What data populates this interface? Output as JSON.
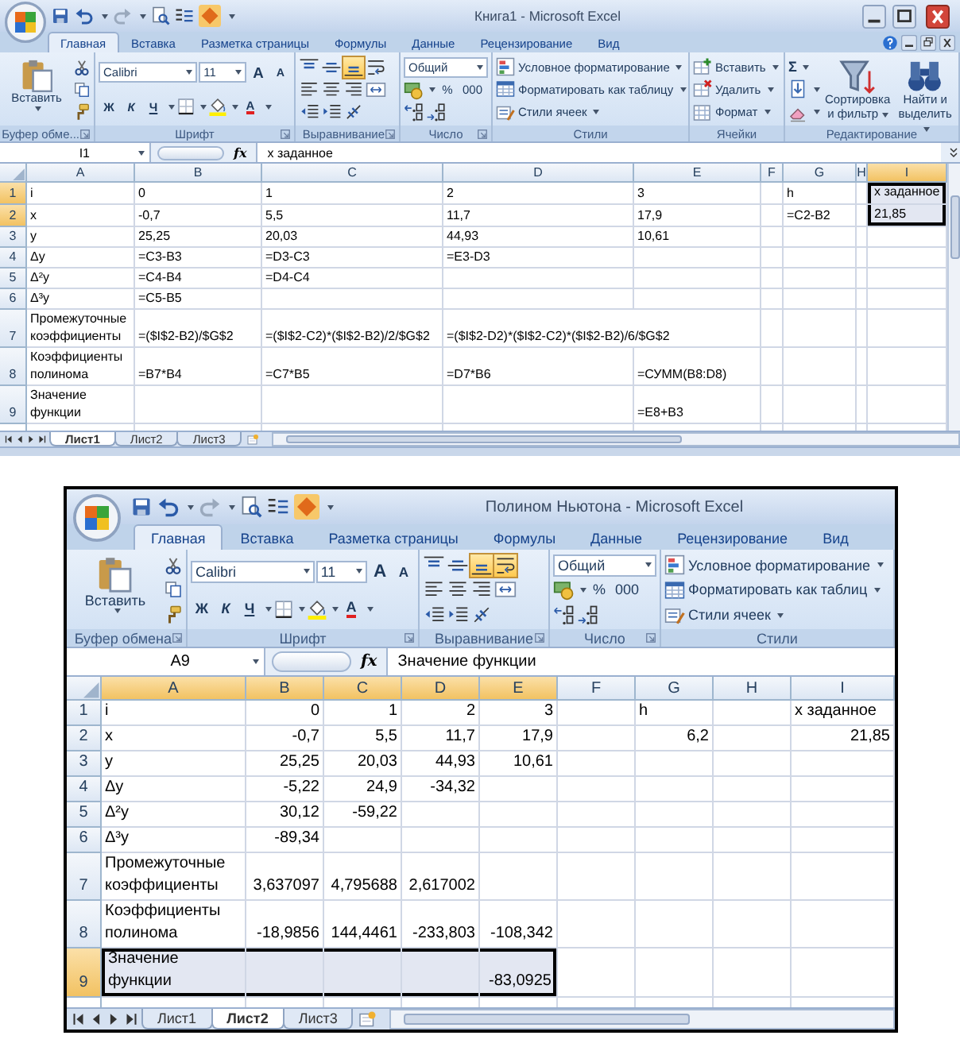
{
  "windows": [
    {
      "title": "Книга1 - Microsoft Excel",
      "tabs": [
        {
          "label": "Главная",
          "selected": true
        },
        {
          "label": "Вставка",
          "selected": false
        },
        {
          "label": "Разметка страницы",
          "selected": false
        },
        {
          "label": "Формулы",
          "selected": false
        },
        {
          "label": "Данные",
          "selected": false
        },
        {
          "label": "Рецензирование",
          "selected": false
        },
        {
          "label": "Вид",
          "selected": false
        }
      ],
      "ribbon": [
        {
          "kind": "clipboard",
          "label": "Буфер обме...",
          "paste": "Вставить"
        },
        {
          "kind": "font",
          "label": "Шрифт",
          "font": "Calibri",
          "size": "11",
          "grow": "A",
          "shrink": "A",
          "bold": "Ж",
          "italic": "К",
          "underline": "Ч",
          "font_color": "A"
        },
        {
          "kind": "alignment",
          "label": "Выравнивание",
          "buttons": [
            {
              "selected": false
            },
            {
              "selected": false
            },
            {
              "selected": true
            },
            {
              "selected": false
            },
            {
              "selected": false
            },
            {
              "selected": false
            },
            {
              "selected": false
            },
            {
              "selected": false
            },
            {
              "selected": false
            },
            {
              "selected": false
            },
            {
              "selected": false
            }
          ]
        },
        {
          "kind": "number",
          "label": "Число",
          "format": "Общий",
          "percent": "%",
          "thousands": "000"
        },
        {
          "kind": "styles",
          "label": "Стили",
          "items": [
            "Условное форматирование",
            "Форматировать как таблицу",
            "Стили ячеек"
          ]
        },
        {
          "kind": "cells",
          "label": "Ячейки",
          "items": [
            "Вставить",
            "Удалить",
            "Формат"
          ]
        },
        {
          "kind": "editing",
          "label": "Редактирование",
          "sum": "Σ",
          "sort": "Сортировка и фильтр",
          "find": "Найти и выделить"
        }
      ],
      "name_box": "I1",
      "formula_button": "fx",
      "formula": "x заданное",
      "columns": [
        {
          "label": "A",
          "selected": false
        },
        {
          "label": "B",
          "selected": false
        },
        {
          "label": "C",
          "selected": false
        },
        {
          "label": "D",
          "selected": false
        },
        {
          "label": "E",
          "selected": false
        },
        {
          "label": "F",
          "selected": false
        },
        {
          "label": "G",
          "selected": false
        },
        {
          "label": "H",
          "selected": false
        },
        {
          "label": "I",
          "selected": true
        }
      ],
      "rows": [
        {
          "label": "1",
          "selected": true,
          "cells": [
            {
              "text": "i",
              "kind": "text",
              "selected": false
            },
            {
              "text": "0",
              "kind": "text",
              "selected": false
            },
            {
              "text": "1",
              "kind": "text",
              "selected": false
            },
            {
              "text": "2",
              "kind": "text",
              "selected": false
            },
            {
              "text": "3",
              "kind": "text",
              "selected": false
            },
            {
              "selected": false
            },
            {
              "text": "h",
              "kind": "text",
              "selected": false
            },
            {
              "selected": false
            },
            {
              "text": "x заданное",
              "kind": "text",
              "selected": true
            }
          ]
        },
        {
          "label": "2",
          "selected": true,
          "cells": [
            {
              "text": "x",
              "kind": "text",
              "selected": false
            },
            {
              "text": "-0,7",
              "kind": "text",
              "selected": false
            },
            {
              "text": "5,5",
              "kind": "text",
              "selected": false
            },
            {
              "text": "11,7",
              "kind": "text",
              "selected": false
            },
            {
              "text": "17,9",
              "kind": "text",
              "selected": false
            },
            {
              "selected": false
            },
            {
              "text": "=C2-B2",
              "kind": "text",
              "selected": false
            },
            {
              "selected": false
            },
            {
              "text": "21,85",
              "kind": "text",
              "selected": true
            }
          ]
        },
        {
          "label": "3",
          "selected": false,
          "cells": [
            {
              "text": "y",
              "kind": "text",
              "selected": false
            },
            {
              "text": "25,25",
              "kind": "text",
              "selected": false
            },
            {
              "text": "20,03",
              "kind": "text",
              "selected": false
            },
            {
              "text": "44,93",
              "kind": "text",
              "selected": false
            },
            {
              "text": "10,61",
              "kind": "text",
              "selected": false
            },
            {
              "selected": false
            },
            {
              "selected": false
            },
            {
              "selected": false
            },
            {
              "selected": false
            }
          ]
        },
        {
          "label": "4",
          "selected": false,
          "cells": [
            {
              "text": "Δy",
              "kind": "text",
              "selected": false
            },
            {
              "text": "=C3-B3",
              "kind": "text",
              "selected": false
            },
            {
              "text": "=D3-C3",
              "kind": "text",
              "selected": false
            },
            {
              "text": "=E3-D3",
              "kind": "text",
              "selected": false
            },
            {
              "selected": false
            },
            {
              "selected": false
            },
            {
              "selected": false
            },
            {
              "selected": false
            },
            {
              "selected": false
            }
          ]
        },
        {
          "label": "5",
          "selected": false,
          "cells": [
            {
              "text": "Δ²y",
              "kind": "text",
              "selected": false
            },
            {
              "text": "=C4-B4",
              "kind": "text",
              "selected": false
            },
            {
              "text": "=D4-C4",
              "kind": "text",
              "selected": false
            },
            {
              "selected": false
            },
            {
              "selected": false
            },
            {
              "selected": false
            },
            {
              "selected": false
            },
            {
              "selected": false
            },
            {
              "selected": false
            }
          ]
        },
        {
          "label": "6",
          "selected": false,
          "cells": [
            {
              "text": "Δ³y",
              "kind": "text",
              "selected": false
            },
            {
              "text": "=C5-B5",
              "kind": "text",
              "selected": false
            },
            {
              "selected": false
            },
            {
              "selected": false
            },
            {
              "selected": false
            },
            {
              "selected": false
            },
            {
              "selected": false
            },
            {
              "selected": false
            },
            {
              "selected": false
            }
          ]
        },
        {
          "label": "7",
          "selected": false,
          "cells": [
            {
              "text": "Промежуточные коэффициенты",
              "kind": "text",
              "selected": false
            },
            {
              "text": "=($I$2-B2)/$G$2",
              "kind": "text",
              "selected": false
            },
            {
              "text": "=($I$2-C2)*($I$2-B2)/2/$G$2",
              "kind": "text",
              "selected": false
            },
            {
              "text": "=($I$2-D2)*($I$2-C2)*($I$2-B2)/6/$G$2",
              "kind": "text",
              "selected": false
            },
            {
              "selected": false
            },
            {
              "selected": false
            },
            {
              "selected": false
            },
            {
              "selected": false
            },
            {
              "selected": false
            }
          ]
        },
        {
          "label": "8",
          "selected": false,
          "cells": [
            {
              "text": "Коэффициенты полинома",
              "kind": "text",
              "selected": false
            },
            {
              "text": "=B7*B4",
              "kind": "text",
              "selected": false
            },
            {
              "text": "=C7*B5",
              "kind": "text",
              "selected": false
            },
            {
              "text": "=D7*B6",
              "kind": "text",
              "selected": false
            },
            {
              "text": "=СУММ(B8:D8)",
              "kind": "text",
              "selected": false
            },
            {
              "selected": false
            },
            {
              "selected": false
            },
            {
              "selected": false
            },
            {
              "selected": false
            }
          ]
        },
        {
          "label": "9",
          "selected": false,
          "cells": [
            {
              "text": "Значение функции",
              "kind": "text",
              "selected": false
            },
            {
              "selected": false
            },
            {
              "selected": false
            },
            {
              "selected": false
            },
            {
              "text": "=E8+B3",
              "kind": "text",
              "selected": false
            },
            {
              "selected": false
            },
            {
              "selected": false
            },
            {
              "selected": false
            },
            {
              "selected": false
            }
          ]
        }
      ],
      "sheets": [
        {
          "label": "Лист1",
          "selected": true
        },
        {
          "label": "Лист2",
          "selected": false
        },
        {
          "label": "Лист3",
          "selected": false
        }
      ]
    },
    {
      "title": "Полином Ньютона - Microsoft Excel",
      "tabs": [
        {
          "label": "Главная",
          "selected": true
        },
        {
          "label": "Вставка",
          "selected": false
        },
        {
          "label": "Разметка страницы",
          "selected": false
        },
        {
          "label": "Формулы",
          "selected": false
        },
        {
          "label": "Данные",
          "selected": false
        },
        {
          "label": "Рецензирование",
          "selected": false
        },
        {
          "label": "Вид",
          "selected": false
        }
      ],
      "ribbon": [
        {
          "kind": "clipboard",
          "label": "Буфер обмена",
          "paste": "Вставить"
        },
        {
          "kind": "font",
          "label": "Шрифт",
          "font": "Calibri",
          "size": "11",
          "grow": "A",
          "shrink": "A",
          "bold": "Ж",
          "italic": "К",
          "underline": "Ч",
          "font_color": "A"
        },
        {
          "kind": "alignment",
          "label": "Выравнивание",
          "buttons": [
            {
              "selected": false
            },
            {
              "selected": false
            },
            {
              "selected": true
            },
            {
              "selected": true
            },
            {
              "selected": false
            },
            {
              "selected": false
            },
            {
              "selected": false
            },
            {
              "selected": false
            },
            {
              "selected": false
            },
            {
              "selected": false
            },
            {
              "selected": false
            }
          ]
        },
        {
          "kind": "number",
          "label": "Число",
          "format": "Общий",
          "percent": "%",
          "thousands": "000"
        },
        {
          "kind": "styles",
          "label": "Стили",
          "items": [
            "Условное форматирование",
            "Форматировать как таблиц",
            "Стили ячеек"
          ]
        }
      ],
      "name_box": "A9",
      "formula_button": "fx",
      "formula": "Значение функции",
      "columns": [
        {
          "label": "A",
          "selected": true
        },
        {
          "label": "B",
          "selected": true
        },
        {
          "label": "C",
          "selected": true
        },
        {
          "label": "D",
          "selected": true
        },
        {
          "label": "E",
          "selected": true
        },
        {
          "label": "F",
          "selected": false
        },
        {
          "label": "G",
          "selected": false
        },
        {
          "label": "H",
          "selected": false
        },
        {
          "label": "I",
          "selected": false
        }
      ],
      "rows": [
        {
          "label": "1",
          "selected": false,
          "cells": [
            {
              "text": "i",
              "kind": "text",
              "selected": false
            },
            {
              "text": "0",
              "kind": "number",
              "selected": false
            },
            {
              "text": "1",
              "kind": "number",
              "selected": false
            },
            {
              "text": "2",
              "kind": "number",
              "selected": false
            },
            {
              "text": "3",
              "kind": "number",
              "selected": false
            },
            {
              "selected": false
            },
            {
              "text": "h",
              "kind": "text",
              "selected": false
            },
            {
              "selected": false
            },
            {
              "text": "x заданное",
              "kind": "text",
              "selected": false
            }
          ]
        },
        {
          "label": "2",
          "selected": false,
          "cells": [
            {
              "text": "x",
              "kind": "text",
              "selected": false
            },
            {
              "text": "-0,7",
              "kind": "number",
              "selected": false
            },
            {
              "text": "5,5",
              "kind": "number",
              "selected": false
            },
            {
              "text": "11,7",
              "kind": "number",
              "selected": false
            },
            {
              "text": "17,9",
              "kind": "number",
              "selected": false
            },
            {
              "selected": false
            },
            {
              "text": "6,2",
              "kind": "number",
              "selected": false
            },
            {
              "selected": false
            },
            {
              "text": "21,85",
              "kind": "number",
              "selected": false
            }
          ]
        },
        {
          "label": "3",
          "selected": false,
          "cells": [
            {
              "text": "y",
              "kind": "text",
              "selected": false
            },
            {
              "text": "25,25",
              "kind": "number",
              "selected": false
            },
            {
              "text": "20,03",
              "kind": "number",
              "selected": false
            },
            {
              "text": "44,93",
              "kind": "number",
              "selected": false
            },
            {
              "text": "10,61",
              "kind": "number",
              "selected": false
            },
            {
              "selected": false
            },
            {
              "selected": false
            },
            {
              "selected": false
            },
            {
              "selected": false
            }
          ]
        },
        {
          "label": "4",
          "selected": false,
          "cells": [
            {
              "text": "Δy",
              "kind": "text",
              "selected": false
            },
            {
              "text": "-5,22",
              "kind": "number",
              "selected": false
            },
            {
              "text": "24,9",
              "kind": "number",
              "selected": false
            },
            {
              "text": "-34,32",
              "kind": "number",
              "selected": false
            },
            {
              "selected": false
            },
            {
              "selected": false
            },
            {
              "selected": false
            },
            {
              "selected": false
            },
            {
              "selected": false
            }
          ]
        },
        {
          "label": "5",
          "selected": false,
          "cells": [
            {
              "text": "Δ²y",
              "kind": "text",
              "selected": false
            },
            {
              "text": "30,12",
              "kind": "number",
              "selected": false
            },
            {
              "text": "-59,22",
              "kind": "number",
              "selected": false
            },
            {
              "selected": false
            },
            {
              "selected": false
            },
            {
              "selected": false
            },
            {
              "selected": false
            },
            {
              "selected": false
            },
            {
              "selected": false
            }
          ]
        },
        {
          "label": "6",
          "selected": false,
          "cells": [
            {
              "text": "Δ³y",
              "kind": "text",
              "selected": false
            },
            {
              "text": "-89,34",
              "kind": "number",
              "selected": false
            },
            {
              "selected": false
            },
            {
              "selected": false
            },
            {
              "selected": false
            },
            {
              "selected": false
            },
            {
              "selected": false
            },
            {
              "selected": false
            },
            {
              "selected": false
            }
          ]
        },
        {
          "label": "7",
          "selected": false,
          "cells": [
            {
              "text": "Промежуточные коэффициенты",
              "kind": "text",
              "selected": false
            },
            {
              "text": "3,637097",
              "kind": "number",
              "selected": false
            },
            {
              "text": "4,795688",
              "kind": "number",
              "selected": false
            },
            {
              "text": "2,617002",
              "kind": "number",
              "selected": false
            },
            {
              "selected": false
            },
            {
              "selected": false
            },
            {
              "selected": false
            },
            {
              "selected": false
            },
            {
              "selected": false
            }
          ]
        },
        {
          "label": "8",
          "selected": false,
          "cells": [
            {
              "text": "Коэффициенты полинома",
              "kind": "text",
              "selected": false
            },
            {
              "text": "-18,9856",
              "kind": "number",
              "selected": false
            },
            {
              "text": "144,4461",
              "kind": "number",
              "selected": false
            },
            {
              "text": "-233,803",
              "kind": "number",
              "selected": false
            },
            {
              "text": "-108,342",
              "kind": "number",
              "selected": false
            },
            {
              "selected": false
            },
            {
              "selected": false
            },
            {
              "selected": false
            },
            {
              "selected": false
            }
          ]
        },
        {
          "label": "9",
          "selected": true,
          "cells": [
            {
              "text": "Значение функции",
              "kind": "text",
              "selected": true
            },
            {
              "selected": true
            },
            {
              "selected": true
            },
            {
              "selected": true
            },
            {
              "text": "-83,0925",
              "kind": "number",
              "selected": true
            },
            {
              "selected": false
            },
            {
              "selected": false
            },
            {
              "selected": false
            },
            {
              "selected": false
            }
          ]
        }
      ],
      "sheets": [
        {
          "label": "Лист1",
          "selected": false
        },
        {
          "label": "Лист2",
          "selected": true
        },
        {
          "label": "Лист3",
          "selected": false
        }
      ]
    }
  ]
}
